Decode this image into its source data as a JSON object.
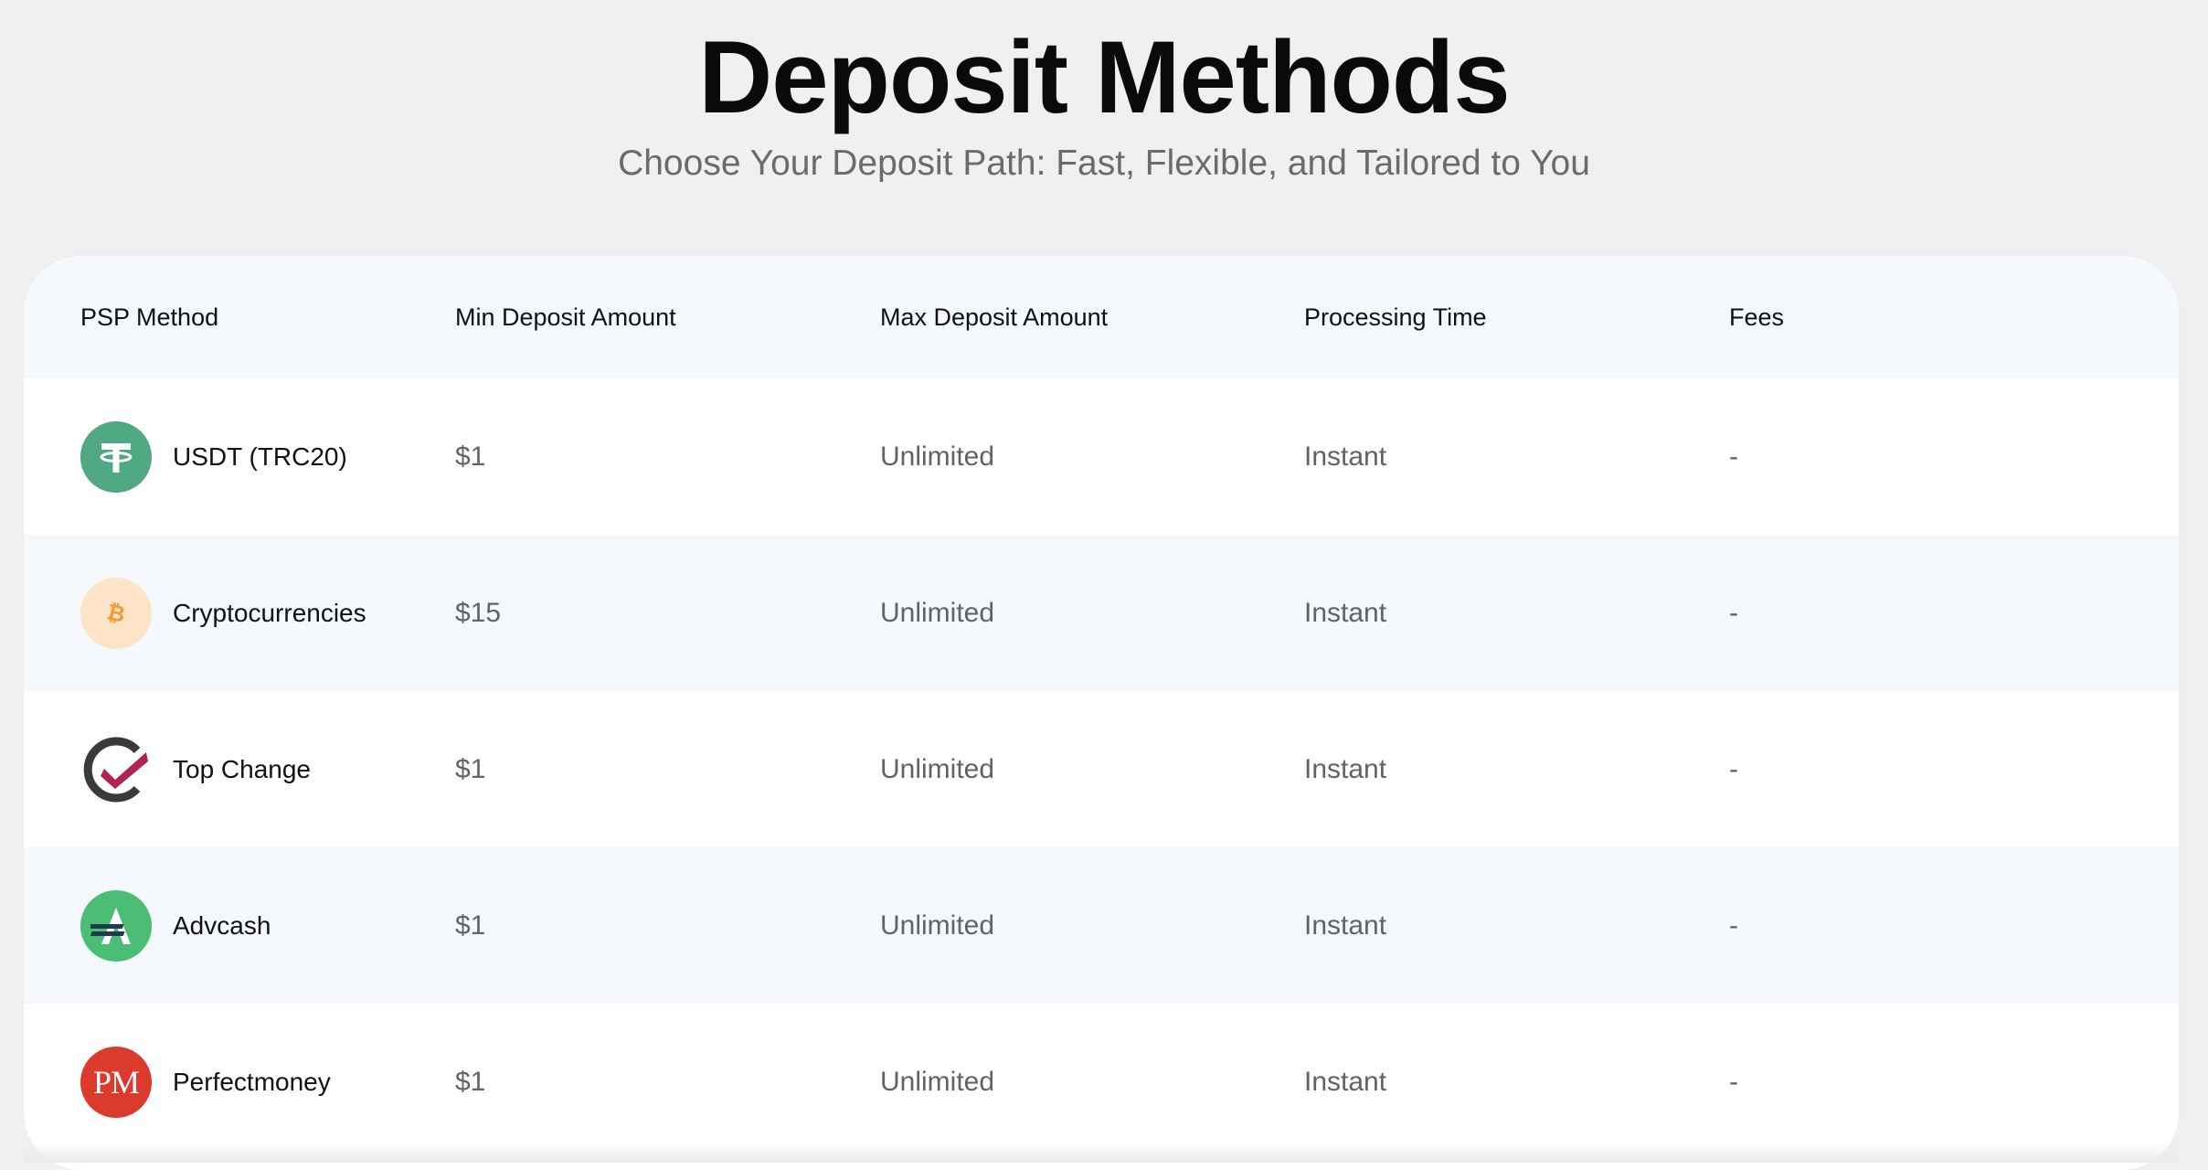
{
  "page": {
    "title": "Deposit Methods",
    "subtitle": "Choose Your Deposit Path: Fast, Flexible, and Tailored to You"
  },
  "table": {
    "columns": [
      "PSP Method",
      "Min Deposit Amount",
      "Max Deposit Amount",
      "Processing Time",
      "Fees"
    ],
    "rows": [
      {
        "method": "USDT (TRC20)",
        "icon": "tether-icon",
        "min": "$1",
        "max": "Unlimited",
        "time": "Instant",
        "fees": "-"
      },
      {
        "method": "Cryptocurrencies",
        "icon": "bitcoin-icon",
        "min": "$15",
        "max": "Unlimited",
        "time": "Instant",
        "fees": "-"
      },
      {
        "method": "Top Change",
        "icon": "topchange-check-icon",
        "min": "$1",
        "max": "Unlimited",
        "time": "Instant",
        "fees": "-"
      },
      {
        "method": "Advcash",
        "icon": "advcash-icon",
        "min": "$1",
        "max": "Unlimited",
        "time": "Instant",
        "fees": "-"
      },
      {
        "method": "Perfectmoney",
        "icon": "perfectmoney-icon",
        "min": "$1",
        "max": "Unlimited",
        "time": "Instant",
        "fees": "-"
      }
    ]
  },
  "logos": {
    "perfectmoney_text": "PM"
  },
  "colors": {
    "background": "#f0f0f0",
    "header_row": "#f5f8fc",
    "tether": "#50a883",
    "bitcoin_bg": "#fde4c6",
    "bitcoin_fg": "#f19a37",
    "topchange_ring": "#3a3a3a",
    "topchange_check": "#b3234f",
    "advcash": "#4cbd74",
    "perfectmoney": "#dc3a2c"
  }
}
